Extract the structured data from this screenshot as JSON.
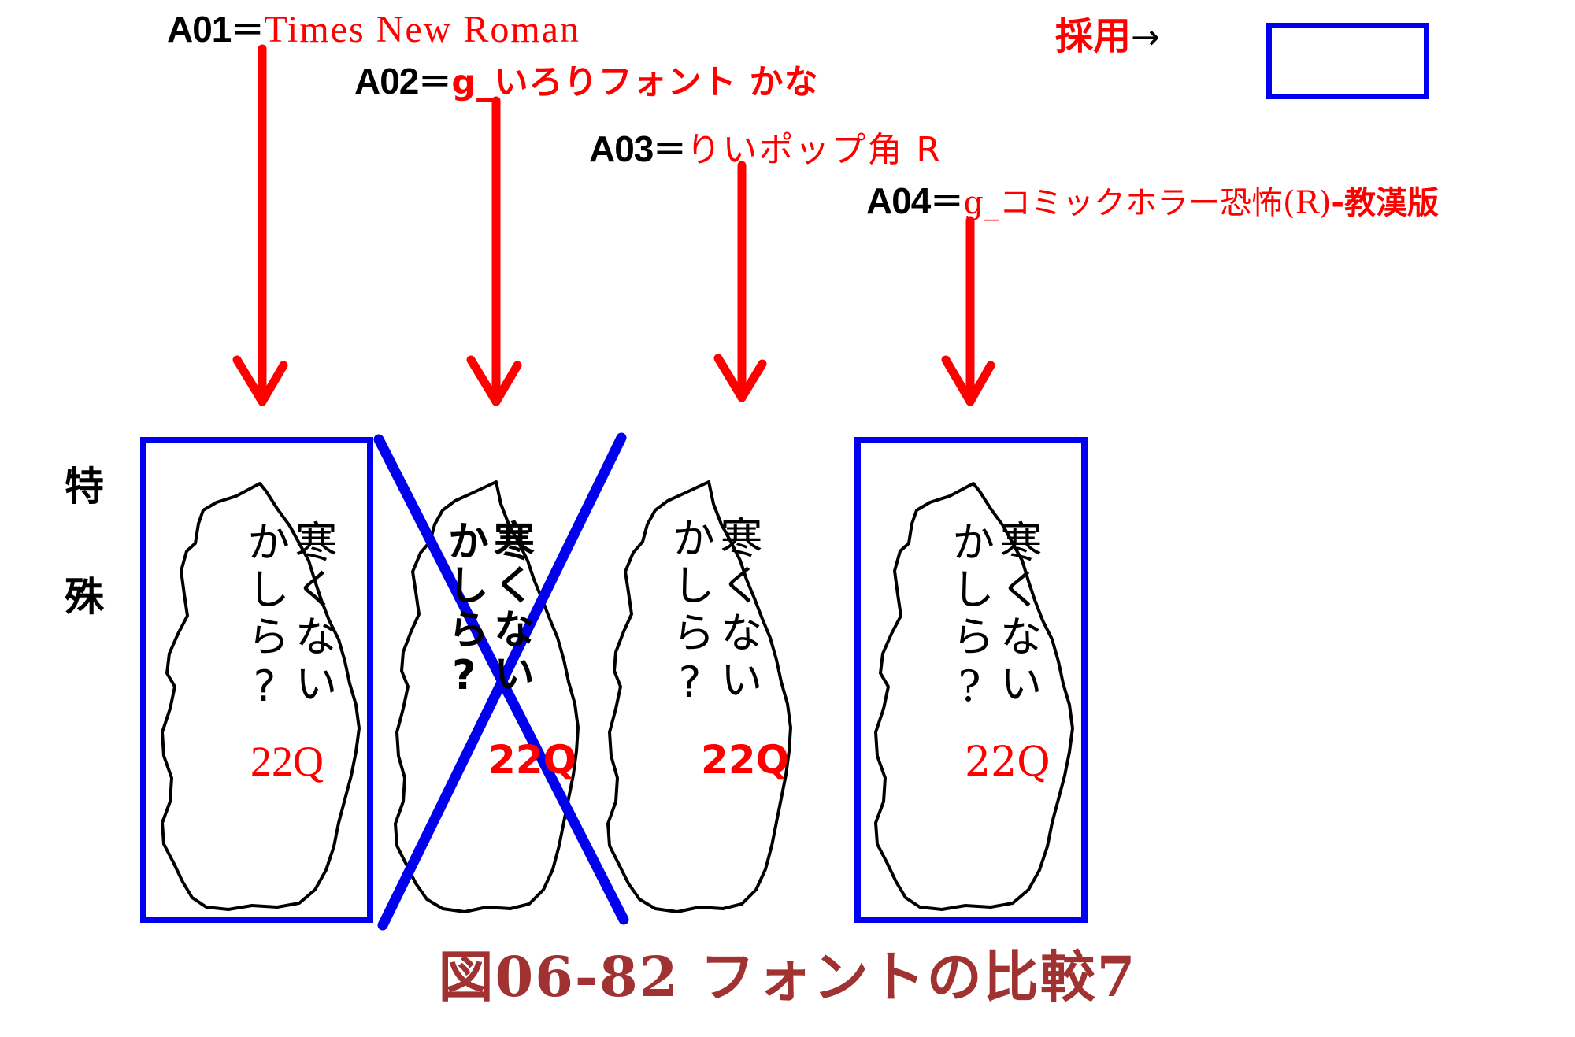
{
  "figure": {
    "caption": "図06-82  フォントの比較7",
    "caption_color": "#a03232",
    "background": "#ffffff"
  },
  "legend": {
    "items": [
      {
        "code": "A01",
        "separator": "＝",
        "font_name": "Times  New  Roman",
        "name_color": "#ff0000",
        "code_color": "#000000"
      },
      {
        "code": "A02",
        "separator": "＝",
        "font_name": "g_いろりフォント かな",
        "name_color": "#ff0000",
        "code_color": "#000000"
      },
      {
        "code": "A03",
        "separator": "＝",
        "font_name": "りいポップ角 R",
        "name_color": "#ff0000",
        "code_color": "#000000"
      },
      {
        "code": "A04",
        "separator": "＝",
        "font_name_prefix": "g_コミックホラー恐怖(R)",
        "font_name_suffix": "-教漢版",
        "font_name": "g_コミックホラー恐怖(R)-教漢版",
        "name_color": "#ff0000",
        "code_color": "#000000"
      }
    ]
  },
  "adopted": {
    "label": "採用",
    "arrow": "→",
    "label_color": "#ff0000",
    "swatch_border_color": "#0000ee"
  },
  "axis": {
    "category_label_chars": [
      "特",
      "殊"
    ]
  },
  "samples": [
    {
      "id": "A01",
      "bubble_line_1": "寒くない",
      "bubble_line_2": "かしら?",
      "size_tag": "22Q",
      "size_tag_color": "#ff0000",
      "selected": true,
      "rejected": false
    },
    {
      "id": "A02",
      "bubble_line_1": "寒くない",
      "bubble_line_2": "かしら?",
      "size_tag": "22Q",
      "size_tag_color": "#ff0000",
      "selected": false,
      "rejected": true
    },
    {
      "id": "A03",
      "bubble_line_1": "寒くない",
      "bubble_line_2": "かしら?",
      "size_tag": "22Q",
      "size_tag_color": "#ff0000",
      "selected": false,
      "rejected": false
    },
    {
      "id": "A04",
      "bubble_line_1": "寒くない",
      "bubble_line_2": "かしら?",
      "size_tag": "22Q",
      "size_tag_color": "#ff0000",
      "selected": true,
      "rejected": false
    }
  ],
  "annotations": {
    "arrow_color": "#ff0000",
    "reject_mark_color": "#0000ee",
    "selection_box_color": "#0000ee"
  }
}
